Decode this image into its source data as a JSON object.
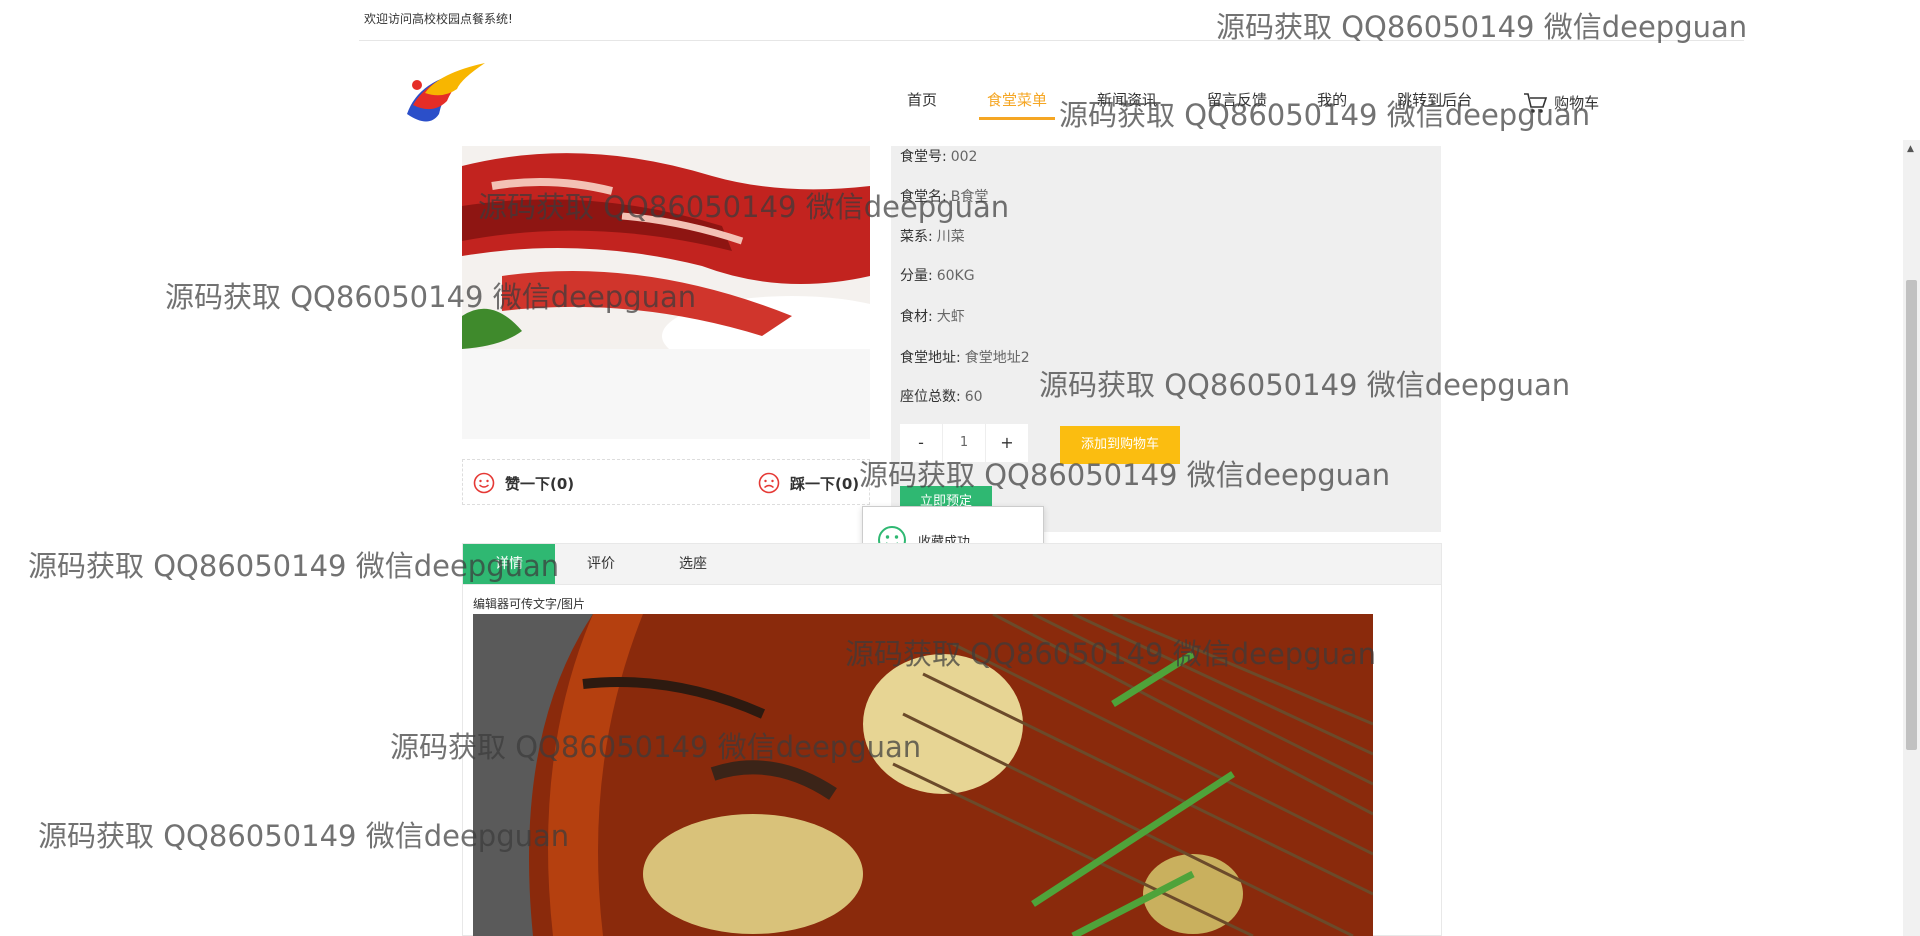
{
  "topbar": {
    "welcome": "欢迎访问高校校园点餐系统!"
  },
  "nav": {
    "items": [
      "首页",
      "食堂菜单",
      "新闻资讯",
      "留言反馈",
      "我的",
      "跳转到后台"
    ],
    "active_index": 1,
    "cart_label": "购物车"
  },
  "details": {
    "rows": [
      {
        "label": "食堂号:",
        "value": "002"
      },
      {
        "label": "食堂名:",
        "value": "B食堂"
      },
      {
        "label": "菜系:",
        "value": "川菜"
      },
      {
        "label": "分量:",
        "value": "60KG"
      },
      {
        "label": "食材:",
        "value": "大虾"
      },
      {
        "label": "食堂地址:",
        "value": "食堂地址2"
      },
      {
        "label": "座位总数:",
        "value": "60"
      }
    ],
    "minus": "-",
    "quantity": "1",
    "plus": "+",
    "add_to_cart": "添加到购物车",
    "buy_now": "立即预定"
  },
  "vote": {
    "like": "赞一下(0)",
    "dislike": "踩一下(0)"
  },
  "toast": {
    "message": "收藏成功"
  },
  "tabs": [
    "详情",
    "评价",
    "选座"
  ],
  "content": {
    "caption": "编辑器可传文字/图片"
  },
  "watermark": "源码获取 QQ86050149 微信deepguan",
  "colors": {
    "accent": "#f5a623",
    "green": "#2fb872",
    "yellow": "#fbbd10"
  }
}
